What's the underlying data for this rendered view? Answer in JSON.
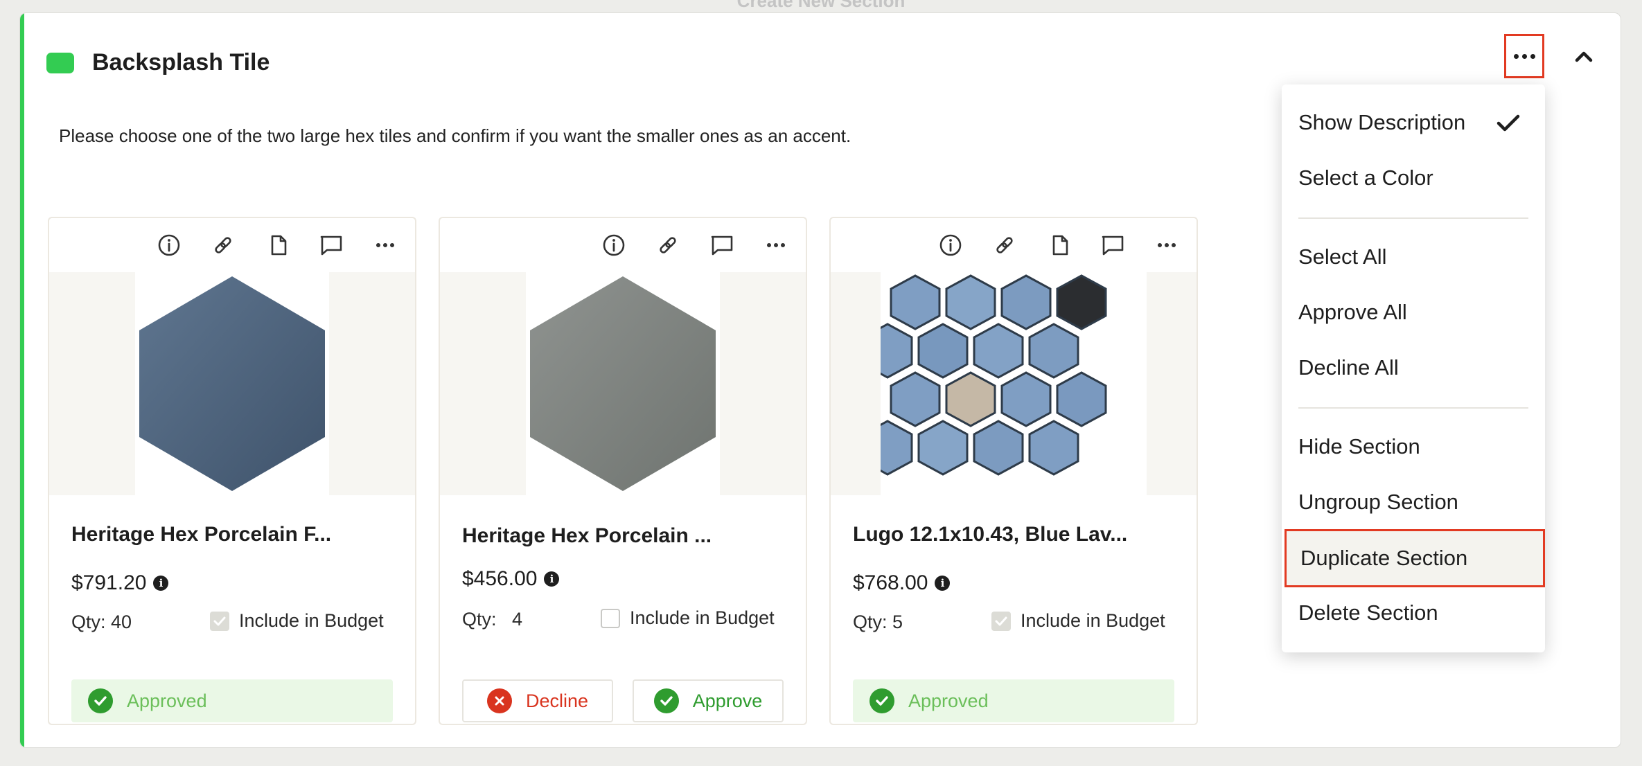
{
  "top_hint": "Create New Section",
  "section": {
    "title": "Backsplash Tile",
    "accent_color": "#33cc52",
    "description": "Please choose one of the two large hex tiles and confirm if you want the smaller ones as an accent."
  },
  "cards": [
    {
      "name": "Heritage Hex Porcelain F...",
      "price": "$791.20",
      "qty": "Qty: 40",
      "include_budget": true,
      "include_budget_label": "Include in Budget",
      "icons": [
        "info-icon",
        "link-icon",
        "document-icon",
        "comment-icon",
        "more-icon"
      ],
      "status": "Approved"
    },
    {
      "name": "Heritage Hex Porcelain ...",
      "price": "$456.00",
      "qty": "Qty:   4",
      "include_budget": false,
      "include_budget_label": "Include in Budget",
      "icons": [
        "info-icon",
        "link-icon",
        "comment-icon",
        "more-icon"
      ],
      "decline_label": "Decline",
      "approve_label": "Approve"
    },
    {
      "name": "Lugo 12.1x10.43, Blue Lav...",
      "price": "$768.00",
      "qty": "Qty: 5",
      "include_budget": true,
      "include_budget_label": "Include in Budget",
      "icons": [
        "info-icon",
        "link-icon",
        "document-icon",
        "comment-icon",
        "more-icon"
      ],
      "status": "Approved"
    }
  ],
  "menu": {
    "items": [
      {
        "label": "Show Description",
        "checked": true
      },
      {
        "label": "Select a Color"
      },
      {
        "label": "Select All"
      },
      {
        "label": "Approve All"
      },
      {
        "label": "Decline All"
      },
      {
        "label": "Hide Section"
      },
      {
        "label": "Ungroup Section"
      },
      {
        "label": "Duplicate Section",
        "highlighted": true
      },
      {
        "label": "Delete Section"
      }
    ]
  },
  "colors": {
    "approved_bg": "#eaf8e6",
    "approved_text": "#6bbf5a",
    "decline_red": "#d9341f",
    "approve_green": "#2f9c2f",
    "highlight_red": "#e23a22"
  }
}
